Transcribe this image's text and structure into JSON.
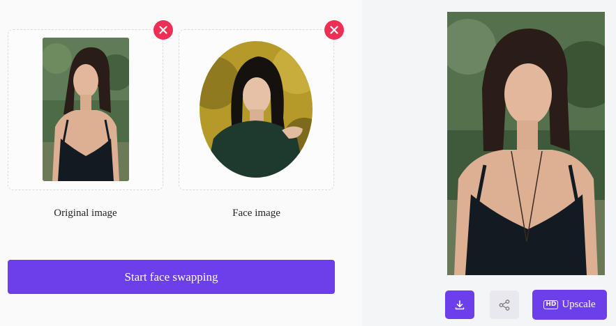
{
  "upload": {
    "original_label": "Original image",
    "face_label": "Face image"
  },
  "actions": {
    "start_label": "Start face swapping",
    "upscale_label": "Upscale",
    "hd_badge": "HD"
  },
  "icons": {
    "remove": "close-icon",
    "download": "download-icon",
    "share": "share-icon",
    "hd": "hd-icon"
  },
  "colors": {
    "accent": "#6c3fea",
    "remove": "#ec2f55",
    "share_bg": "#e8e8ee"
  }
}
